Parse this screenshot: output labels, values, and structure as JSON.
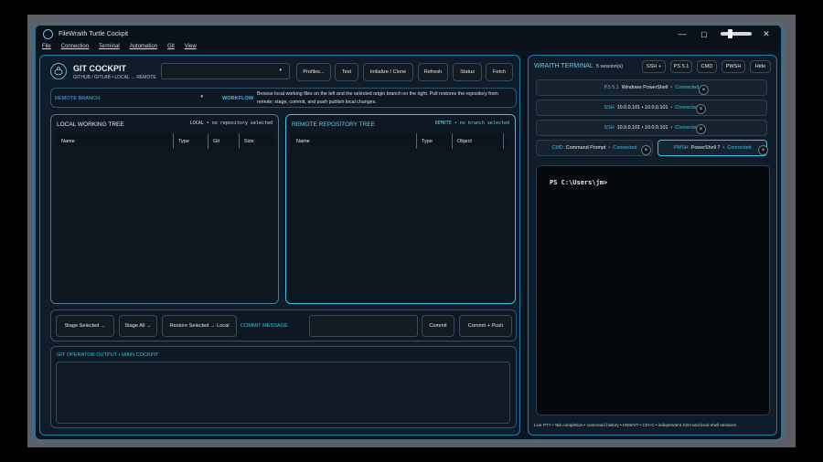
{
  "window": {
    "title": "FileWraith Turtle Cockpit",
    "minimize_glyph": "—",
    "maximize_glyph": "▢",
    "close_glyph": "✕"
  },
  "menu": [
    "File",
    "Connection",
    "Terminal",
    "Automation",
    "Git",
    "View"
  ],
  "cockpit": {
    "title": "GIT COCKPIT",
    "subtitle": "GITHUB / GITLAB • LOCAL → REMOTE",
    "profile_select_value": "",
    "buttons": {
      "profiles": "Profiles...",
      "test": "Test",
      "init_clone": "Initialize / Clone",
      "refresh": "Refresh",
      "status": "Status",
      "fetch": "Fetch"
    },
    "remote_branch_label": "REMOTE BRANCH",
    "remote_branch_value": "",
    "workflow_label": "WORKFLOW",
    "workflow_text": "Browse local working files on the left and the selected origin branch on the right. Pull restores the repository from remote; stage, commit, and push publish local changes."
  },
  "local_tree": {
    "title": "LOCAL WORKING TREE",
    "status": "LOCAL • no repository selected",
    "columns": [
      "Name",
      "Type",
      "Git",
      "Size"
    ]
  },
  "remote_tree": {
    "title": "REMOTE REPOSITORY TREE",
    "status": "REMOTE • no branch selected",
    "columns": [
      "Name",
      "Type",
      "Object"
    ]
  },
  "commit_bar": {
    "stage_selected": "Stage Selected →",
    "stage_all": "Stage All →",
    "restore_selected": "Restore Selected → Local",
    "commit_message_label": "COMMIT MESSAGE",
    "commit_message_value": "",
    "commit": "Commit",
    "commit_push": "Commit + Push"
  },
  "output": {
    "title": "GIT OPERATOR OUTPUT • MAIN COCKPIT"
  },
  "terminal": {
    "title": "WRAITH TERMINAL",
    "session_count": "5 session(s)",
    "buttons": {
      "ssh_plus": "SSH +",
      "ps51": "PS 5.1",
      "cmd": "CMD",
      "pwsh": "PWSH",
      "hide": "Hide"
    },
    "sessions": [
      {
        "kind": "PS 5.1",
        "name": "Windows PowerShell",
        "sep": "•",
        "state": "Connected"
      },
      {
        "kind": "SSH",
        "name": "10.0.0.101 • 10.0.0.101",
        "sep": "•",
        "state": "Connected"
      },
      {
        "kind": "SSH",
        "name": "10.0.0.101 • 10.0.0.101",
        "sep": "•",
        "state": "Connected"
      },
      {
        "kind": "CMD",
        "name": "Command Prompt",
        "sep": "•",
        "state": "Connected"
      },
      {
        "kind": "PWSH",
        "name": "PowerShell 7",
        "sep": "•",
        "state": "Connected"
      }
    ],
    "close_glyph": "×",
    "prompt": "PS C:\\Users\\jm>",
    "footer": "Live PTY • Tab completion • command history • ANSI/VT • Ctrl+C • independent SSH and local shell sessions"
  },
  "colors": {
    "accent": "#34c3eb",
    "border": "#1f80ad",
    "background": "#0b1520"
  }
}
